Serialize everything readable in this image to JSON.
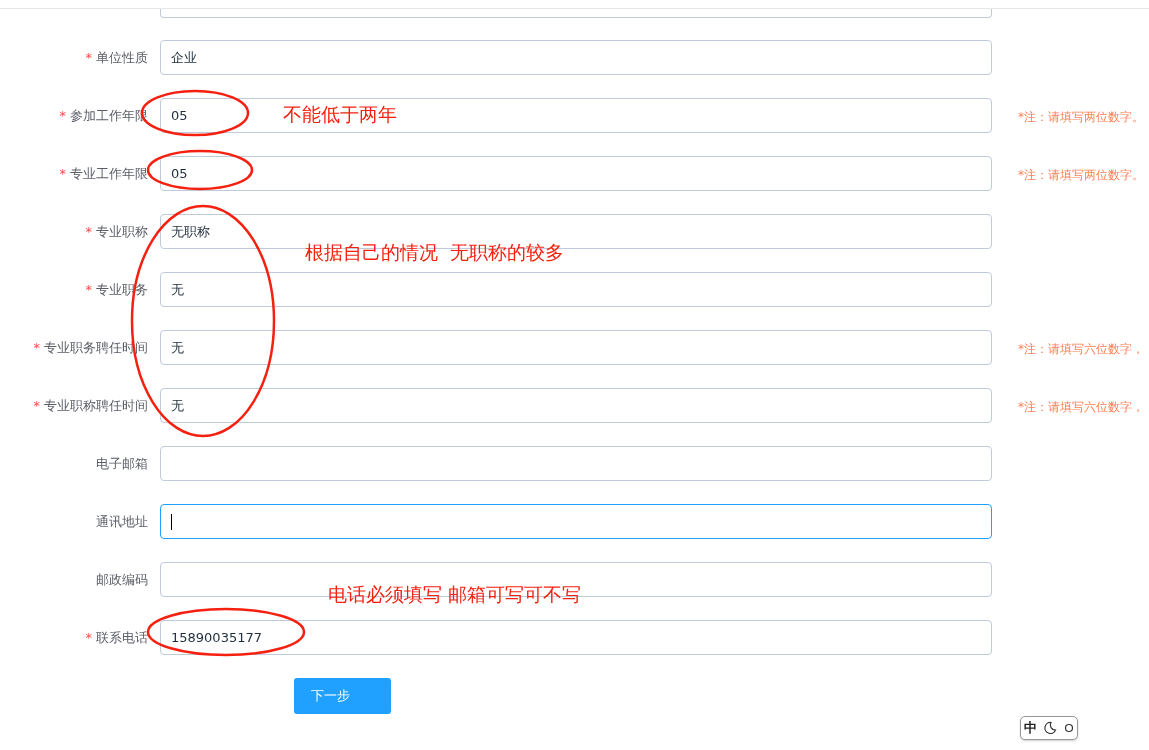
{
  "form": {
    "rows": [
      {
        "required_mark": "*",
        "label": "单位性质",
        "value": "企业",
        "focused": false
      },
      {
        "required_mark": "*",
        "label": "参加工作年限",
        "value": "05",
        "focused": false,
        "note": "*注：请填写两位数字。"
      },
      {
        "required_mark": "*",
        "label": "专业工作年限",
        "value": "05",
        "focused": false,
        "note": "*注：请填写两位数字。"
      },
      {
        "required_mark": "*",
        "label": "专业职称",
        "value": "无职称",
        "focused": false
      },
      {
        "required_mark": "*",
        "label": "专业职务",
        "value": "无",
        "focused": false
      },
      {
        "required_mark": "*",
        "label": "专业职务聘任时间",
        "value": "无",
        "focused": false,
        "note": "*注：请填写六位数字，"
      },
      {
        "required_mark": "*",
        "label": "专业职称聘任时间",
        "value": "无",
        "focused": false,
        "note": "*注：请填写六位数字，"
      },
      {
        "label": "电子邮箱",
        "focused": false
      },
      {
        "label": "通讯地址",
        "focused": true
      },
      {
        "label": "邮政编码",
        "focused": false
      },
      {
        "required_mark": "*",
        "label": "联系电话",
        "value": "15890035177",
        "focused": false
      }
    ],
    "next_button": "下一步"
  },
  "annotations": [
    {
      "kind": "ellipse"
    },
    {
      "kind": "ellipse"
    },
    {
      "kind": "ellipse"
    },
    {
      "kind": "ellipse"
    },
    {
      "kind": "text",
      "text": "不能低于两年"
    },
    {
      "kind": "text",
      "text": "根据自己的情况  无职称的较多"
    },
    {
      "kind": "text",
      "text": "电话必须填写 邮箱可写可不写"
    }
  ],
  "ime_toolbar": {
    "mode": "中"
  }
}
